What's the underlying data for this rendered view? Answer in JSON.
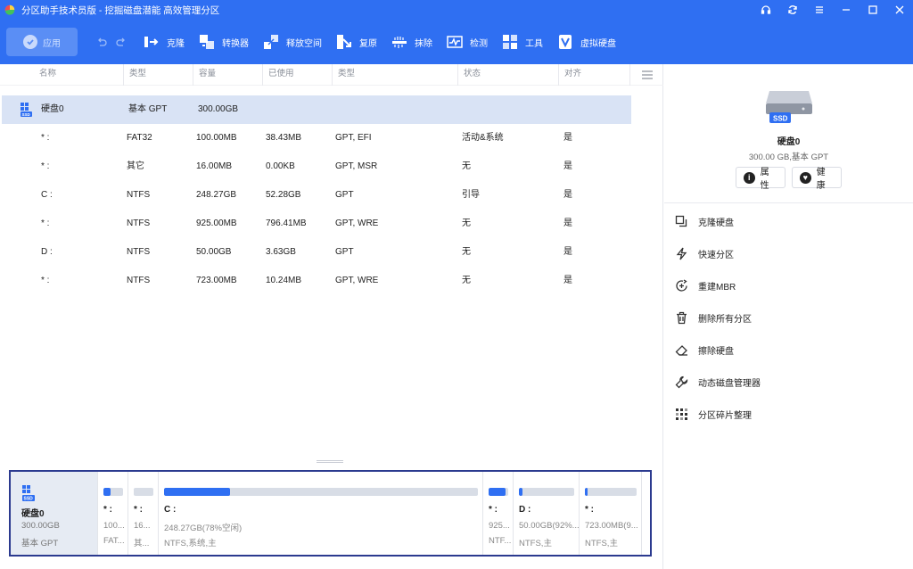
{
  "titlebar": {
    "title": "分区助手技术员版 - 挖掘磁盘潜能 高效管理分区",
    "controls": [
      "headset-icon",
      "refresh-icon",
      "menu-icon",
      "minimize-icon",
      "maximize-icon",
      "close-icon"
    ]
  },
  "toolbar": {
    "apply_label": "应用",
    "tools": [
      {
        "label": "克隆",
        "icon": "clone-icon"
      },
      {
        "label": "转换器",
        "icon": "convert-icon"
      },
      {
        "label": "释放空间",
        "icon": "free-space-icon"
      },
      {
        "label": "复原",
        "icon": "restore-icon"
      },
      {
        "label": "抹除",
        "icon": "wipe-icon"
      },
      {
        "label": "检测",
        "icon": "detect-icon"
      },
      {
        "label": "工具",
        "icon": "tools-icon"
      },
      {
        "label": "虚拟硬盘",
        "icon": "virtual-disk-icon"
      }
    ]
  },
  "table": {
    "headers": [
      "名称",
      "类型",
      "容量",
      "已使用",
      "类型",
      "状态",
      "对齐"
    ],
    "disk_row": {
      "name": "硬盘0",
      "type": "基本 GPT",
      "capacity": "300.00GB"
    },
    "rows": [
      {
        "name": "* :",
        "type": "FAT32",
        "capacity": "100.00MB",
        "used": "38.43MB",
        "ptype": "GPT, EFI",
        "status": "活动&系统",
        "align": "是"
      },
      {
        "name": "* :",
        "type": "其它",
        "capacity": "16.00MB",
        "used": "0.00KB",
        "ptype": "GPT, MSR",
        "status": "无",
        "align": "是"
      },
      {
        "name": "C :",
        "type": "NTFS",
        "capacity": "248.27GB",
        "used": "52.28GB",
        "ptype": "GPT",
        "status": "引导",
        "align": "是"
      },
      {
        "name": "* :",
        "type": "NTFS",
        "capacity": "925.00MB",
        "used": "796.41MB",
        "ptype": "GPT, WRE",
        "status": "无",
        "align": "是"
      },
      {
        "name": "D :",
        "type": "NTFS",
        "capacity": "50.00GB",
        "used": "3.63GB",
        "ptype": "GPT",
        "status": "无",
        "align": "是"
      },
      {
        "name": "* :",
        "type": "NTFS",
        "capacity": "723.00MB",
        "used": "10.24MB",
        "ptype": "GPT, WRE",
        "status": "无",
        "align": "是"
      }
    ]
  },
  "diskmap": {
    "disk": {
      "name": "硬盘0",
      "size": "300.00GB",
      "type": "基本 GPT",
      "badge": "SSD"
    },
    "segments": [
      {
        "label": "* :",
        "line2": "100...",
        "line3": "FAT...",
        "used_fraction": 0.38
      },
      {
        "label": "* :",
        "line2": "16...",
        "line3": "其...",
        "used_fraction": 0.0
      },
      {
        "label": "C :",
        "line2": "248.27GB(78%空闲)",
        "line3": "NTFS,系统,主",
        "used_fraction": 0.21
      },
      {
        "label": "* :",
        "line2": "925...",
        "line3": "NTF...",
        "used_fraction": 0.86
      },
      {
        "label": "D :",
        "line2": "50.00GB(92%...",
        "line3": "NTFS,主",
        "used_fraction": 0.07
      },
      {
        "label": "* :",
        "line2": "723.00MB(9...",
        "line3": "NTFS,主",
        "used_fraction": 0.01
      }
    ]
  },
  "right_panel": {
    "disk_badge": "SSD",
    "disk_name": "硬盘0",
    "disk_info": "300.00 GB,基本 GPT",
    "properties_label": "属性",
    "health_label": "健康",
    "operations": [
      {
        "label": "克隆硬盘",
        "icon": "clone-disk-icon"
      },
      {
        "label": "快速分区",
        "icon": "lightning-icon"
      },
      {
        "label": "重建MBR",
        "icon": "rebuild-mbr-icon"
      },
      {
        "label": "删除所有分区",
        "icon": "trash-icon"
      },
      {
        "label": "擦除硬盘",
        "icon": "eraser-icon"
      },
      {
        "label": "动态磁盘管理器",
        "icon": "wrench-icon"
      },
      {
        "label": "分区碎片整理",
        "icon": "defrag-icon"
      }
    ]
  },
  "colors": {
    "accent": "#2f6ff2",
    "selected_row": "#d9e3f5",
    "map_border": "#2b3a8f"
  }
}
